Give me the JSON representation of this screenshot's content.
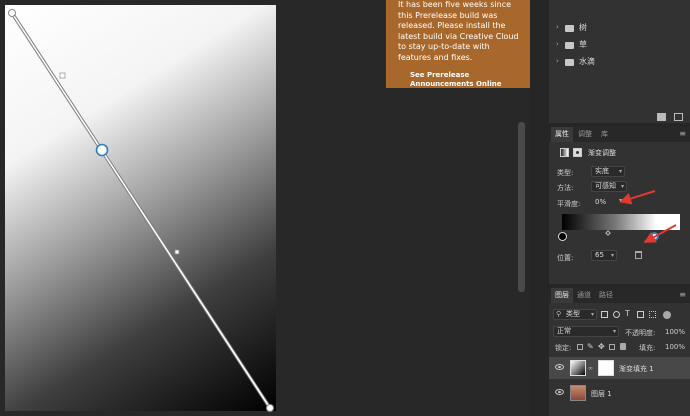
{
  "notification": {
    "message": "It has been five weeks since this Prerelease build was released. Please install the latest build via Creative Cloud to stay up-to-date with features and fixes.",
    "link": "See Prerelease Announcements Online"
  },
  "top_panel": {
    "items": [
      {
        "label": "树"
      },
      {
        "label": "草"
      },
      {
        "label": "水滴"
      }
    ]
  },
  "properties": {
    "tabs": [
      {
        "label": "属性"
      },
      {
        "label": "调整"
      },
      {
        "label": "库"
      }
    ],
    "section_title": "渐变调整",
    "type_label": "类型:",
    "type_value": "实底",
    "method_label": "方法:",
    "method_value": "可感知",
    "smoothness_label": "平滑度:",
    "smoothness_value": "0%",
    "location_label": "位置:",
    "location_value": "65",
    "stop_location": 65
  },
  "layers": {
    "tabs": [
      {
        "label": "图层"
      },
      {
        "label": "通道"
      },
      {
        "label": "路径"
      }
    ],
    "filter_value": "类型",
    "blend_mode": "正常",
    "opacity_label": "不透明度:",
    "opacity_value": "100%",
    "lock_label": "锁定:",
    "fill_label": "填充:",
    "fill_value": "100%",
    "list": [
      {
        "name": "渐变填充 1",
        "selected": true
      },
      {
        "name": "图层 1",
        "selected": false
      }
    ]
  },
  "colors": {
    "notice_bg": "#a9682b",
    "annotation_arrow": "#e03a2f",
    "handle_blue": "#2a7fc4"
  }
}
